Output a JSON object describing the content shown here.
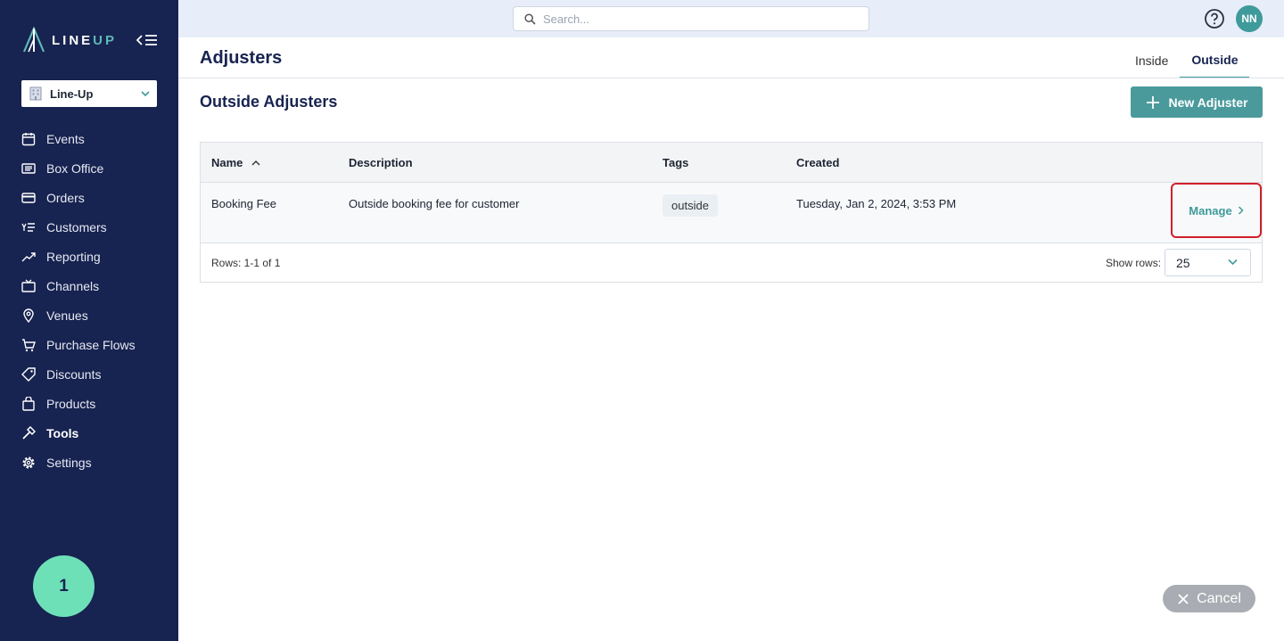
{
  "brand": {
    "line": "LINE",
    "up": "UP"
  },
  "org_selector": {
    "value": "Line-Up"
  },
  "nav": [
    {
      "label": "Events",
      "icon": "calendar-icon",
      "active": false
    },
    {
      "label": "Box Office",
      "icon": "ticket-icon",
      "active": false
    },
    {
      "label": "Orders",
      "icon": "credit-card-icon",
      "active": false
    },
    {
      "label": "Customers",
      "icon": "customers-list-icon",
      "active": false
    },
    {
      "label": "Reporting",
      "icon": "trend-chart-icon",
      "active": false
    },
    {
      "label": "Channels",
      "icon": "tv-icon",
      "active": false
    },
    {
      "label": "Venues",
      "icon": "map-pin-icon",
      "active": false
    },
    {
      "label": "Purchase Flows",
      "icon": "cart-icon",
      "active": false
    },
    {
      "label": "Discounts",
      "icon": "tag-icon",
      "active": false
    },
    {
      "label": "Products",
      "icon": "bag-icon",
      "active": false
    },
    {
      "label": "Tools",
      "icon": "hammer-icon",
      "active": true
    },
    {
      "label": "Settings",
      "icon": "gear-icon",
      "active": false
    }
  ],
  "step_badge": "1",
  "search": {
    "placeholder": "Search..."
  },
  "user": {
    "initials": "NN"
  },
  "page": {
    "title": "Adjusters",
    "tabs": [
      {
        "label": "Inside",
        "active": false
      },
      {
        "label": "Outside",
        "active": true
      }
    ],
    "section_title": "Outside Adjusters",
    "new_button": "New Adjuster"
  },
  "table": {
    "columns": [
      "Name",
      "Description",
      "Tags",
      "Created"
    ],
    "sort_column": "Name",
    "rows": [
      {
        "name": "Booking Fee",
        "description": "Outside booking fee for customer",
        "tag": "outside",
        "created": "Tuesday, Jan 2, 2024, 3:53 PM",
        "action": "Manage"
      }
    ],
    "rows_summary": "Rows: 1-1 of 1",
    "show_rows_label": "Show rows:",
    "rows_per_page": "25"
  },
  "cancel_button": "Cancel",
  "colors": {
    "sidebar": "#172350",
    "accent": "#4a9a9c",
    "badge": "#6ee0b8",
    "highlight": "#d0202a"
  }
}
